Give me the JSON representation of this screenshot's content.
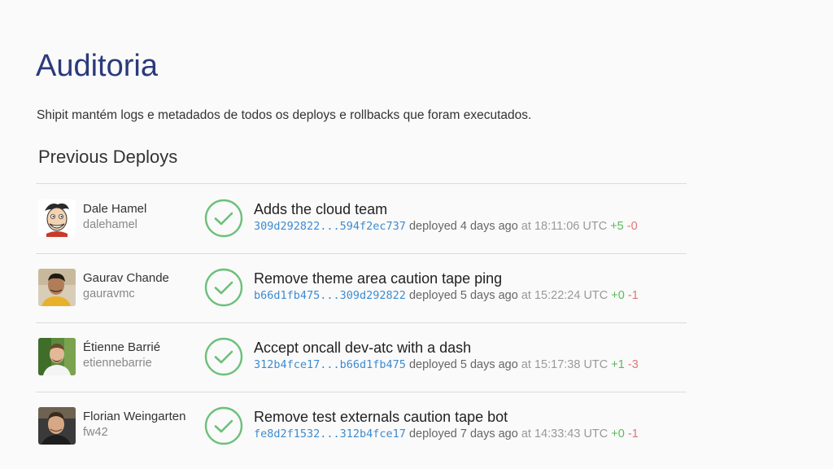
{
  "slide": {
    "title": "Auditoria",
    "subtitle": "Shipit mantém logs e metadados de todos os deploys e rollbacks que foram executados."
  },
  "section": {
    "heading": "Previous Deploys"
  },
  "deploys": [
    {
      "author_name": "Dale Hamel",
      "author_login": "dalehamel",
      "title": "Adds the cloud team",
      "commit_range": "309d292822...594f2ec737",
      "deployed_label": "deployed",
      "relative_time": "4 days ago",
      "at_label": "at",
      "timestamp": "18:11:06 UTC",
      "additions": "+5",
      "deletions": "-0"
    },
    {
      "author_name": "Gaurav Chande",
      "author_login": "gauravmc",
      "title": "Remove theme area caution tape ping",
      "commit_range": "b66d1fb475...309d292822",
      "deployed_label": "deployed",
      "relative_time": "5 days ago",
      "at_label": "at",
      "timestamp": "15:22:24 UTC",
      "additions": "+0",
      "deletions": "-1"
    },
    {
      "author_name": "Étienne Barrié",
      "author_login": "etiennebarrie",
      "title": "Accept oncall dev-atc with a dash",
      "commit_range": "312b4fce17...b66d1fb475",
      "deployed_label": "deployed",
      "relative_time": "5 days ago",
      "at_label": "at",
      "timestamp": "15:17:38 UTC",
      "additions": "+1",
      "deletions": "-3"
    },
    {
      "author_name": "Florian Weingarten",
      "author_login": "fw42",
      "title": "Remove test externals caution tape bot",
      "commit_range": "fe8d2f1532...312b4fce17",
      "deployed_label": "deployed",
      "relative_time": "7 days ago",
      "at_label": "at",
      "timestamp": "14:33:43 UTC",
      "additions": "+0",
      "deletions": "-1"
    }
  ],
  "icons": {
    "status": "check-circle-icon",
    "avatar": "avatar-photo"
  },
  "colors": {
    "title": "#2b3a7a",
    "success_green": "#6cc07a",
    "commit_blue": "#3d8bd1",
    "additions_green": "#5bb85b",
    "deletions_red": "#e57373"
  }
}
